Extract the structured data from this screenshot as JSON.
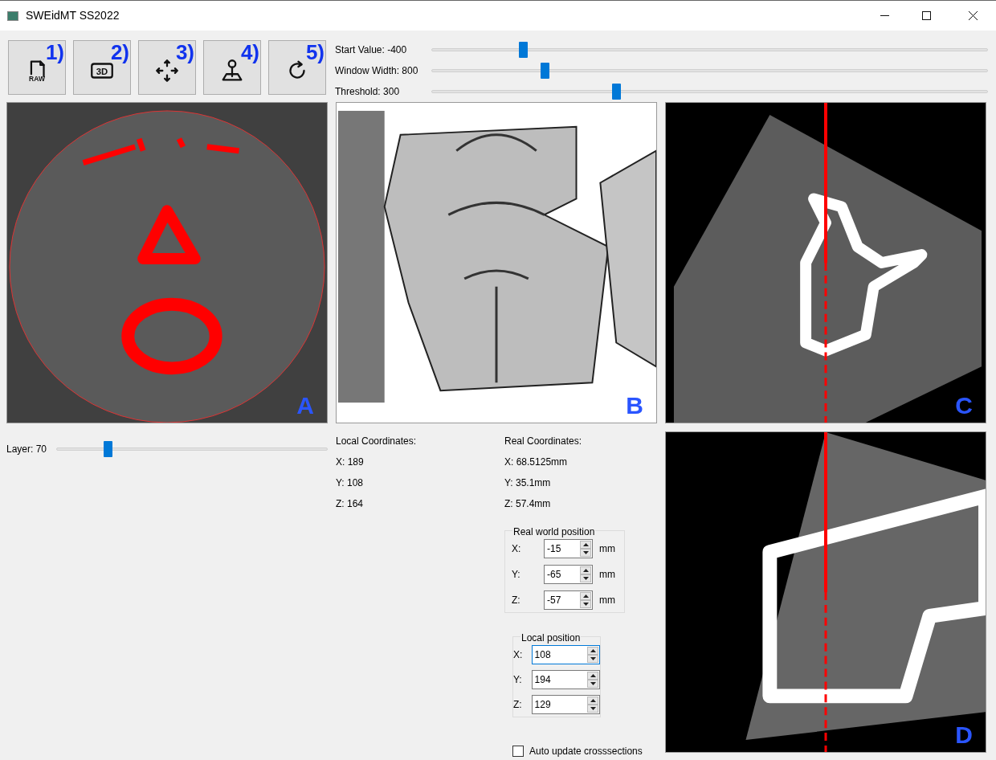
{
  "window": {
    "title": "SWEidMT SS2022"
  },
  "toolbar": [
    {
      "kind": "raw",
      "icon_text": "RAW",
      "number": "1)"
    },
    {
      "kind": "threed",
      "icon_text": "3D",
      "number": "2)"
    },
    {
      "kind": "move",
      "number": "3)"
    },
    {
      "kind": "joystick",
      "number": "4)"
    },
    {
      "kind": "reset",
      "number": "5)"
    }
  ],
  "sliders": [
    {
      "label": "Start Value: -400",
      "level": 0.16
    },
    {
      "label": "Window Width: 800",
      "level": 0.2
    },
    {
      "label": "Threshold: 300",
      "level": 0.33
    }
  ],
  "views": [
    {
      "kind": "axial",
      "letter": "A"
    },
    {
      "kind": "volume",
      "letter": "B"
    },
    {
      "kind": "cross1",
      "letter": "C"
    },
    {
      "kind": "cross2",
      "letter": "D"
    }
  ],
  "layer": {
    "label": "Layer: 70",
    "level": 0.18
  },
  "local_coordinates": {
    "title": "Local Coordinates:",
    "lines": [
      "X: 189",
      "Y: 108",
      "Z: 164"
    ]
  },
  "real_coordinates": {
    "title": "Real Coordinates:",
    "lines": [
      "X: 68.5125mm",
      "Y: 35.1mm",
      "Z: 57.4mm"
    ]
  },
  "real_world_position": {
    "title": "Real world position",
    "fields": [
      {
        "label": "X:",
        "value": "-15",
        "unit": "mm"
      },
      {
        "label": "Y:",
        "value": "-65",
        "unit": "mm"
      },
      {
        "label": "Z:",
        "value": "-57",
        "unit": "mm"
      }
    ]
  },
  "local_position": {
    "title": "Local position",
    "fields": [
      {
        "label": "X:",
        "value": "108",
        "focused": true
      },
      {
        "label": "Y:",
        "value": "194",
        "focused": false
      },
      {
        "label": "Z:",
        "value": "129",
        "focused": false
      }
    ]
  },
  "auto_update": {
    "label": "Auto update crosssections",
    "checked": false
  }
}
